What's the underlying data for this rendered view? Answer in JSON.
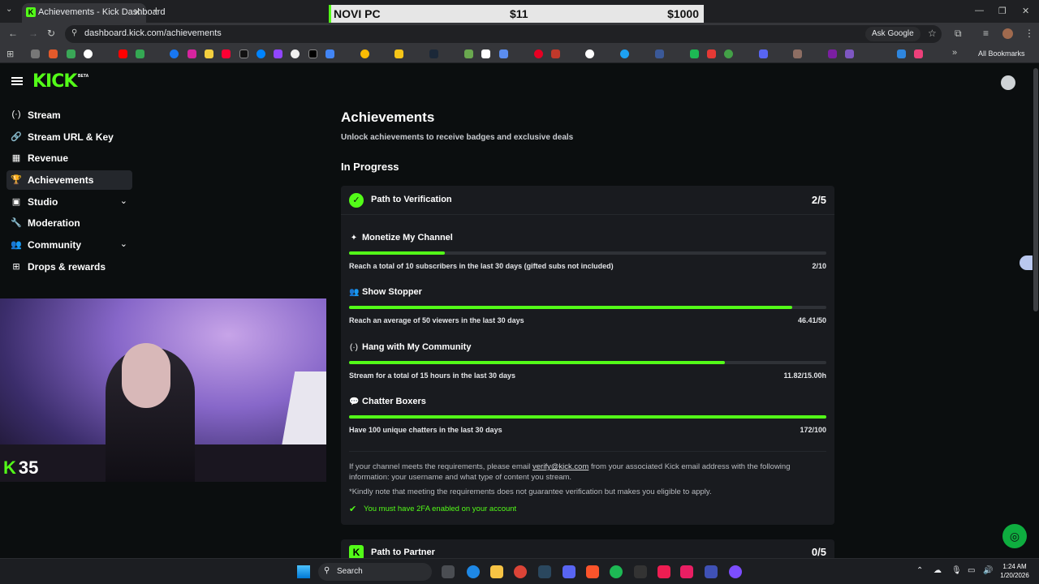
{
  "browser": {
    "tab_title": "Achievements - Kick Dashboard",
    "tab_close": "✕",
    "new_tab": "+",
    "url": "dashboard.kick.com/achievements",
    "ask_google": "Ask Google",
    "all_bookmarks": "All Bookmarks"
  },
  "overlay": {
    "name": "NOVI PC",
    "current": "$11",
    "goal": "$1000",
    "progress_fraction": 0.011
  },
  "brand": {
    "logo": "KICK",
    "beta": "BETA",
    "accent": "#53fc18"
  },
  "sidebar": {
    "items": [
      {
        "label": "Stream",
        "icon": "(·)"
      },
      {
        "label": "Stream URL & Key",
        "icon": "🔗"
      },
      {
        "label": "Revenue",
        "icon": "▦"
      },
      {
        "label": "Achievements",
        "icon": "🏆",
        "active": true
      },
      {
        "label": "Studio",
        "icon": "▣",
        "expandable": true
      },
      {
        "label": "Moderation",
        "icon": "🔧"
      },
      {
        "label": "Community",
        "icon": "👥",
        "expandable": true
      },
      {
        "label": "Drops & rewards",
        "icon": "⊞"
      }
    ]
  },
  "webcam": {
    "count_icon": "K",
    "count": "35"
  },
  "main": {
    "title": "Achievements",
    "subtitle": "Unlock achievements to receive badges and exclusive deals",
    "section": "In Progress",
    "verification": {
      "title": "Path to Verification",
      "count": "2/5",
      "achievements": [
        {
          "name": "Monetize My Channel",
          "icon": "✦",
          "desc": "Reach a total of 10 subscribers in the last 30 days (gifted subs not included)",
          "value": "2/10",
          "progress": 0.2
        },
        {
          "name": "Show Stopper",
          "icon": "👥",
          "desc": "Reach an average of 50 viewers in the last 30 days",
          "value": "46.41/50",
          "progress": 0.928
        },
        {
          "name": "Hang with My Community",
          "icon": "(·)",
          "desc": "Stream for a total of 15 hours in the last 30 days",
          "value": "11.82/15.00h",
          "progress": 0.788
        },
        {
          "name": "Chatter Boxers",
          "icon": "💬",
          "desc": "Have 100 unique chatters in the last 30 days",
          "value": "172/100",
          "progress": 1.0
        }
      ],
      "info_before": "If your channel meets the requirements, please email ",
      "info_link": "verify@kick.com",
      "info_after": " from your associated Kick email address with the following information: your username and what type of content you stream.",
      "note": "*Kindly note that meeting the requirements does not guarantee verification but makes you eligible to apply.",
      "check_mark": "✔",
      "twofa": "You must have 2FA enabled on your account"
    },
    "partner": {
      "icon": "K",
      "title": "Path to Partner",
      "count": "0/5"
    }
  },
  "taskbar": {
    "search": "Search",
    "time": "1:24 AM",
    "date": "1/20/2026"
  }
}
